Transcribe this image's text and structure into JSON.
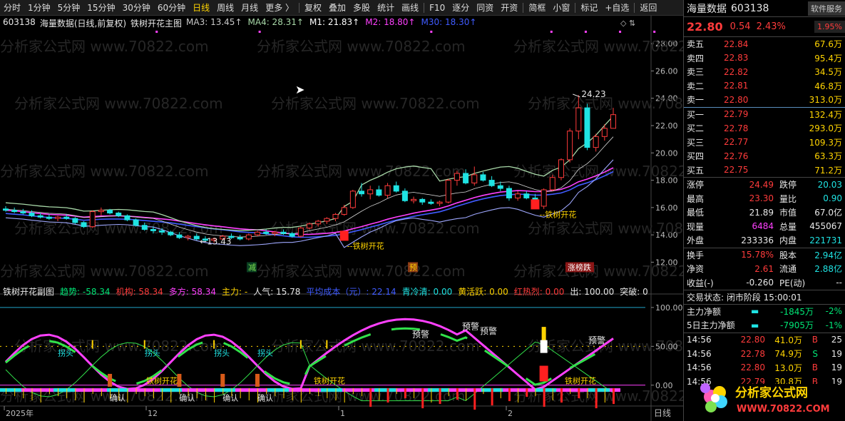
{
  "toolbar": {
    "items": [
      "分时",
      "1分钟",
      "5分钟",
      "15分钟",
      "30分钟",
      "60分钟",
      "日线",
      "周线",
      "月线",
      "更多 〉",
      "复权",
      "叠加",
      "多股",
      "统计",
      "画线",
      "F10",
      "逐分",
      "同资",
      "开资",
      "简框",
      "小窗",
      "标记",
      "+自选",
      "返回"
    ],
    "active": "日线"
  },
  "main_chart": {
    "code": "603138",
    "name": "海量数据",
    "period": "(日线,前复权)",
    "indicator": "铁树开花主图",
    "ma": [
      {
        "label": "MA3:",
        "value": "13.45",
        "color": "#c8c8c8"
      },
      {
        "label": "MA4:",
        "value": "28.31",
        "color": "#a8d8a8"
      },
      {
        "label": "M1:",
        "value": "21.83",
        "color": "#ffffff"
      },
      {
        "label": "M2:",
        "value": "18.80",
        "color": "#ff40ff"
      },
      {
        "label": "M30:",
        "value": "18.30",
        "color": "#3f5bff"
      }
    ],
    "y_ticks": [
      "28.00",
      "26.00",
      "24.00",
      "22.00",
      "20.00",
      "18.00",
      "16.00",
      "14.00",
      "12.00"
    ],
    "annotations": {
      "high": "24.23",
      "low": "13.43",
      "signal1": "--铁树开花",
      "signal2": "--铁树开花",
      "reduce": "减",
      "pre": "预",
      "limit": "涨榜跌"
    }
  },
  "sub_chart": {
    "title": "铁树开花副图",
    "legend": [
      {
        "label": "趋势:",
        "value": "-58.34",
        "color": "#00e676"
      },
      {
        "label": "机构:",
        "value": "58.34",
        "color": "#ff3b3b"
      },
      {
        "label": "多方:",
        "value": "58.34",
        "color": "#ff40ff"
      },
      {
        "label": "主力:",
        "value": "-",
        "color": "#ffd400"
      },
      {
        "label": "人气:",
        "value": "15.78",
        "color": "#e8e8e8"
      },
      {
        "label": "平均成本（元）:",
        "value": "22.14",
        "color": "#3f5bff"
      },
      {
        "label": "青冷清:",
        "value": "0.00",
        "color": "#1fe3e3"
      },
      {
        "label": "黄活跃:",
        "value": "0.00",
        "color": "#ffd400"
      },
      {
        "label": "红热烈:",
        "value": "0.00",
        "color": "#ff3b3b"
      },
      {
        "label": "出:",
        "value": "100.00",
        "color": "#e8e8e8"
      },
      {
        "label": "突破:",
        "value": "0",
        "color": "#e8e8e8"
      }
    ],
    "y_ticks": [
      "100.00",
      "50.00",
      "0.00"
    ],
    "labels": {
      "tt": "拐头",
      "confirm": "确认",
      "tree": "铁树开花",
      "warn": "预警"
    }
  },
  "x_axis": {
    "labels": [
      "2025年",
      "12",
      "1",
      "2"
    ],
    "period": "日线"
  },
  "quote": {
    "name": "海量数据",
    "code": "603138",
    "service": "软件服务",
    "price": "22.80",
    "change": "0.54",
    "pct": "2.43%",
    "turnover_pct": "1.95%",
    "asks": [
      {
        "l": "卖五",
        "p": "22.84",
        "v": "67.6万"
      },
      {
        "l": "卖四",
        "p": "22.83",
        "v": "95.4万"
      },
      {
        "l": "卖三",
        "p": "22.82",
        "v": "34.5万"
      },
      {
        "l": "卖二",
        "p": "22.81",
        "v": "46.8万"
      },
      {
        "l": "卖一",
        "p": "22.80",
        "v": "313.0万"
      }
    ],
    "bids": [
      {
        "l": "买一",
        "p": "22.79",
        "v": "132.4万"
      },
      {
        "l": "买二",
        "p": "22.78",
        "v": "293.0万"
      },
      {
        "l": "买三",
        "p": "22.77",
        "v": "109.3万"
      },
      {
        "l": "买四",
        "p": "22.76",
        "v": "63.3万"
      },
      {
        "l": "买五",
        "p": "22.75",
        "v": "71.2万"
      }
    ],
    "stats": [
      {
        "a": "涨停",
        "b": "24.49",
        "c": "跌停",
        "d": "20.03"
      },
      {
        "a": "最高",
        "b": "23.30",
        "c": "量比",
        "d": "0.90"
      },
      {
        "a": "最低",
        "b": "21.89",
        "c": "市值",
        "d": "67.0亿"
      },
      {
        "a": "现量",
        "b": "6484",
        "c": "总量",
        "d": "455067"
      },
      {
        "a": "外盘",
        "b": "233336",
        "c": "内盘",
        "d": "221731"
      }
    ],
    "stats2": [
      {
        "a": "换手",
        "b": "15.78%",
        "c": "股本",
        "d": "2.94亿"
      },
      {
        "a": "净资",
        "b": "2.61",
        "c": "流通",
        "d": "2.88亿"
      },
      {
        "a": "收益(-)",
        "b": "-0.260",
        "c": "PE(动)",
        "d": "--"
      }
    ],
    "status": "交易状态: 闭市阶段 15:00:01",
    "flows": [
      {
        "l": "主力净额",
        "v": "-1845万",
        "p": "-2%"
      },
      {
        "l": "5日主力净额",
        "v": "-7905万",
        "p": "-1%"
      }
    ],
    "ticks": [
      {
        "t": "14:56",
        "p": "22.80",
        "v": "41.0万",
        "s": "B",
        "n": "25"
      },
      {
        "t": "14:56",
        "p": "22.78",
        "v": "74.9万",
        "s": "S",
        "n": "19"
      },
      {
        "t": "14:56",
        "p": "22.80",
        "v": "13.0万",
        "s": "B",
        "n": "19"
      },
      {
        "t": "14:56",
        "p": "22.79",
        "v": "30.8万",
        "s": "B",
        "n": "19"
      }
    ]
  },
  "logo": {
    "title": "分析家公式网",
    "url": "WWW.70822.COM"
  },
  "watermark": "分析家公式网 www.70822.com",
  "chart_data": [
    {
      "type": "candlestick",
      "title": "海量数据(日线,前复权)",
      "ylim": [
        11.5,
        29
      ],
      "ohlc": [
        [
          15.9,
          16.1,
          15.7,
          15.8
        ],
        [
          15.8,
          16.0,
          15.6,
          15.7
        ],
        [
          15.7,
          15.9,
          15.5,
          15.6
        ],
        [
          15.6,
          15.8,
          15.3,
          15.4
        ],
        [
          15.4,
          15.6,
          15.2,
          15.3
        ],
        [
          15.3,
          15.5,
          15.1,
          15.2
        ],
        [
          15.2,
          15.4,
          15.0,
          15.3
        ],
        [
          15.3,
          15.5,
          15.1,
          15.2
        ],
        [
          15.2,
          15.3,
          14.8,
          14.9
        ],
        [
          14.9,
          15.0,
          14.5,
          14.6
        ],
        [
          14.6,
          15.8,
          14.5,
          15.7
        ],
        [
          15.7,
          16.0,
          15.4,
          15.8
        ],
        [
          15.8,
          15.9,
          15.5,
          15.6
        ],
        [
          15.6,
          15.7,
          15.3,
          15.4
        ],
        [
          15.4,
          15.5,
          15.0,
          15.1
        ],
        [
          15.1,
          15.2,
          14.6,
          14.7
        ],
        [
          14.7,
          14.9,
          14.3,
          14.4
        ],
        [
          14.4,
          14.6,
          14.1,
          14.3
        ],
        [
          14.3,
          14.5,
          14.0,
          14.2
        ],
        [
          14.2,
          14.3,
          13.9,
          14.0
        ],
        [
          14.0,
          14.2,
          13.7,
          13.8
        ],
        [
          13.8,
          14.0,
          13.6,
          13.9
        ],
        [
          13.9,
          14.1,
          13.6,
          13.7
        ],
        [
          13.7,
          13.9,
          13.5,
          13.6
        ],
        [
          13.6,
          13.8,
          13.43,
          13.7
        ],
        [
          13.7,
          14.0,
          13.6,
          13.9
        ],
        [
          13.9,
          14.1,
          13.7,
          13.8
        ],
        [
          13.8,
          14.0,
          13.6,
          13.7
        ],
        [
          13.7,
          14.1,
          13.6,
          14.0
        ],
        [
          14.0,
          14.3,
          13.9,
          14.2
        ],
        [
          14.2,
          14.4,
          14.0,
          14.1
        ],
        [
          14.1,
          14.3,
          13.9,
          14.2
        ],
        [
          14.2,
          14.4,
          14.0,
          14.1
        ],
        [
          14.1,
          14.2,
          13.8,
          13.9
        ],
        [
          13.9,
          14.6,
          13.8,
          14.5
        ],
        [
          14.5,
          14.9,
          14.4,
          14.8
        ],
        [
          14.8,
          15.1,
          14.6,
          15.0
        ],
        [
          15.0,
          15.3,
          14.8,
          15.2
        ],
        [
          15.2,
          15.6,
          15.0,
          15.5
        ],
        [
          15.5,
          16.2,
          15.4,
          16.0
        ],
        [
          16.0,
          17.3,
          15.9,
          17.2
        ],
        [
          17.2,
          17.8,
          16.8,
          17.0
        ],
        [
          17.0,
          17.6,
          16.6,
          17.3
        ],
        [
          17.3,
          17.6,
          16.8,
          16.9
        ],
        [
          16.9,
          17.8,
          16.7,
          17.6
        ],
        [
          17.6,
          17.9,
          17.1,
          17.2
        ],
        [
          17.2,
          17.4,
          16.4,
          16.5
        ],
        [
          16.5,
          16.8,
          16.3,
          16.6
        ],
        [
          16.6,
          16.7,
          16.2,
          16.4
        ],
        [
          16.4,
          16.6,
          16.2,
          16.3
        ],
        [
          16.3,
          16.5,
          16.1,
          16.4
        ],
        [
          16.4,
          18.1,
          16.3,
          18.0
        ],
        [
          18.0,
          18.7,
          17.6,
          18.5
        ],
        [
          18.5,
          18.8,
          17.7,
          17.8
        ],
        [
          17.8,
          19.0,
          17.6,
          18.4
        ],
        [
          18.4,
          18.6,
          17.9,
          18.0
        ],
        [
          18.0,
          18.3,
          17.5,
          17.6
        ],
        [
          17.6,
          17.9,
          17.2,
          17.4
        ],
        [
          17.4,
          17.6,
          16.5,
          16.7
        ],
        [
          16.7,
          17.2,
          16.5,
          17.0
        ],
        [
          17.0,
          17.2,
          16.6,
          16.7
        ],
        [
          16.7,
          17.0,
          15.9,
          16.1
        ],
        [
          16.1,
          17.4,
          15.9,
          17.3
        ],
        [
          17.3,
          18.4,
          17.2,
          18.2
        ],
        [
          18.2,
          19.6,
          18.0,
          19.5
        ],
        [
          19.5,
          21.8,
          19.3,
          21.6
        ],
        [
          21.6,
          24.23,
          21.0,
          23.3
        ],
        [
          23.3,
          23.6,
          20.2,
          20.4
        ],
        [
          20.4,
          21.4,
          20.1,
          21.2
        ],
        [
          21.2,
          22.1,
          20.9,
          21.8
        ],
        [
          21.8,
          23.3,
          21.89,
          22.8
        ]
      ]
    },
    {
      "type": "line",
      "title": "铁树开花副图",
      "ylim": [
        -25,
        110
      ],
      "series": [
        {
          "name": "趋势",
          "values": [
            -58.34
          ]
        },
        {
          "name": "机构",
          "values": [
            58.34
          ]
        },
        {
          "name": "多方",
          "values": [
            58.34
          ]
        }
      ]
    }
  ]
}
